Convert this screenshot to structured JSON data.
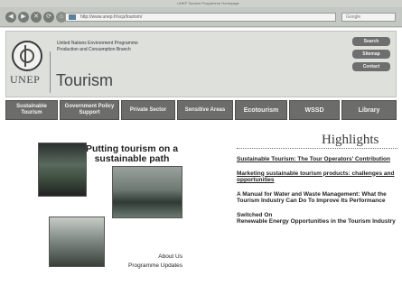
{
  "browser": {
    "window_title": "UNEP Tourism Programme Homepage",
    "url": "http://www.unep.fr/scp/tourism/",
    "search_placeholder": "Google",
    "nav_buttons": [
      "◀",
      "▶",
      "✕",
      "⟳",
      "⌂"
    ]
  },
  "header": {
    "org_line1": "United Nations Environment Programme",
    "org_line2": "Production and Consumption Branch",
    "logo_text": "UNEP",
    "title": "Tourism",
    "side_buttons": [
      "Search",
      "Sitemap",
      "Contact"
    ]
  },
  "nav": {
    "tabs": [
      "Sustainable Tourism",
      "Government Policy Support",
      "Private Sector",
      "Sensitive Areas",
      "Ecotourism",
      "WSSD",
      "Library"
    ]
  },
  "hero": {
    "title": "Putting tourism on a sustainable path",
    "links": [
      "About Us",
      "Programme Updates"
    ]
  },
  "highlights": {
    "heading": "Highlights",
    "items": [
      "Sustainable Tourism: The Tour Operators' Contribution",
      "Marketing sustainable tourism products: challenges and opportunities",
      "A Manual for Water and Waste Management: What the Tourism Industry Can Do To Improve Its Performance",
      "Switched On",
      "Renewable Energy Opportunities in the Tourism Industry"
    ]
  },
  "colors": {
    "nav_tab": "#6c6c6a",
    "header_bg": "#dee0dc",
    "page_bg": "#ffffff"
  }
}
